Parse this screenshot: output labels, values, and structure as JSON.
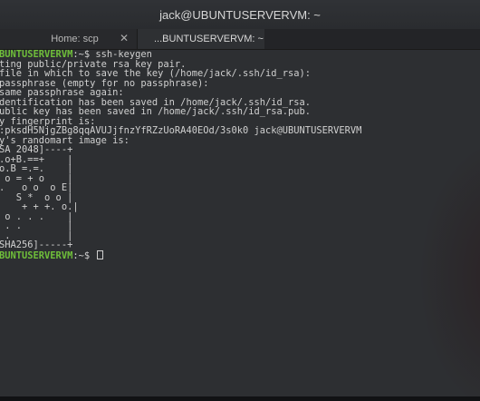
{
  "window": {
    "title": "jack@UBUNTUSERVERVM: ~"
  },
  "tabs": [
    {
      "label": "Home: scp",
      "close_icon": "✕"
    },
    {
      "label": "...BUNTUSERVERVM: ~"
    }
  ],
  "terminal": {
    "lines": [
      {
        "prompt": "BUNTUSERVERVM",
        "text": ":~$ ssh-keygen"
      },
      {
        "text": "ting public/private rsa key pair."
      },
      {
        "text": "file in which to save the key (/home/jack/.ssh/id_rsa):"
      },
      {
        "text": "passphrase (empty for no passphrase):"
      },
      {
        "text": "same passphrase again:"
      },
      {
        "text": "dentification has been saved in /home/jack/.ssh/id_rsa."
      },
      {
        "text": "ublic key has been saved in /home/jack/.ssh/id_rsa.pub."
      },
      {
        "text": "y fingerprint is:"
      },
      {
        "text": ":pksdH5NjgZBg8qqAVUJjfnzYfRZzUoRA40EOd/3s0k0 jack@UBUNTUSERVERVM"
      },
      {
        "text": "y's randomart image is:"
      },
      {
        "text": "SA 2048]----+"
      },
      {
        "text": ".o+B.==+    |"
      },
      {
        "text": "o.B =.=.    |"
      },
      {
        "text": " o = + o    |"
      },
      {
        "text": ".   o o  o E|"
      },
      {
        "text": "   S *  o o |"
      },
      {
        "text": "    + + +. o.|"
      },
      {
        "text": " o . . .    |"
      },
      {
        "text": " . .        |"
      },
      {
        "text": " .          |"
      },
      {
        "text": "SHA256]-----+"
      },
      {
        "prompt": "BUNTUSERVERVM",
        "text": ":~$ ",
        "cursor": true
      }
    ]
  }
}
